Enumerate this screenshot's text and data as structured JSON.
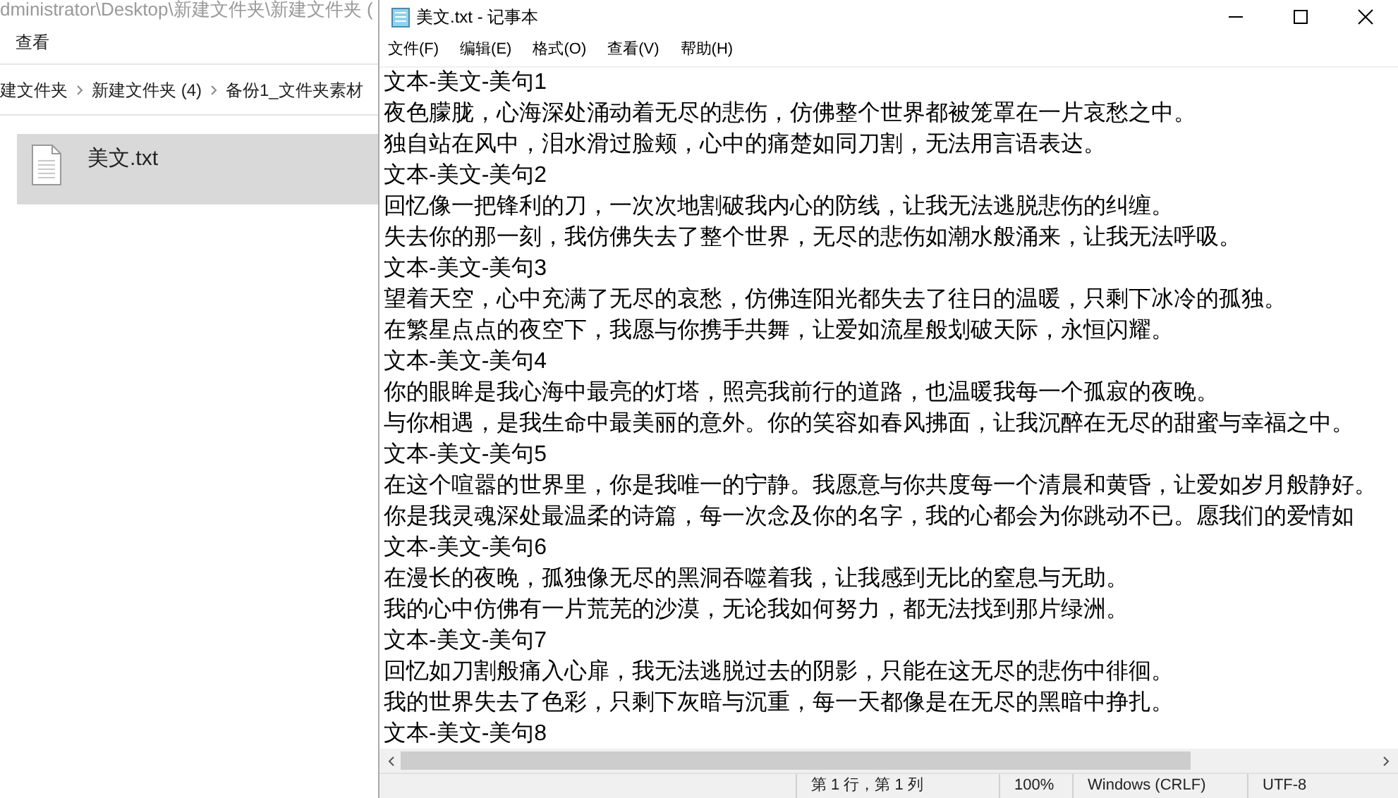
{
  "explorer": {
    "address": "dministrator\\Desktop\\新建文件夹\\新建文件夹 (",
    "ribbon_tab": "查看",
    "breadcrumb": [
      "建文件夹",
      "新建文件夹 (4)",
      "备份1_文件夹素材"
    ],
    "files": [
      {
        "name": "美文.txt",
        "selected": true
      }
    ]
  },
  "notepad": {
    "title": "美文.txt - 记事本",
    "menu": [
      "文件(F)",
      "编辑(E)",
      "格式(O)",
      "查看(V)",
      "帮助(H)"
    ],
    "lines": [
      "文本-美文-美句1",
      "夜色朦胧，心海深处涌动着无尽的悲伤，仿佛整个世界都被笼罩在一片哀愁之中。",
      "独自站在风中，泪水滑过脸颊，心中的痛楚如同刀割，无法用言语表达。",
      "文本-美文-美句2",
      "回忆像一把锋利的刀，一次次地割破我内心的防线，让我无法逃脱悲伤的纠缠。",
      "失去你的那一刻，我仿佛失去了整个世界，无尽的悲伤如潮水般涌来，让我无法呼吸。",
      "文本-美文-美句3",
      "望着天空，心中充满了无尽的哀愁，仿佛连阳光都失去了往日的温暖，只剩下冰冷的孤独。",
      "在繁星点点的夜空下，我愿与你携手共舞，让爱如流星般划破天际，永恒闪耀。",
      "文本-美文-美句4",
      "你的眼眸是我心海中最亮的灯塔，照亮我前行的道路，也温暖我每一个孤寂的夜晚。",
      "与你相遇，是我生命中最美丽的意外。你的笑容如春风拂面，让我沉醉在无尽的甜蜜与幸福之中。",
      "文本-美文-美句5",
      "在这个喧嚣的世界里，你是我唯一的宁静。我愿意与你共度每一个清晨和黄昏，让爱如岁月般静好。",
      "你是我灵魂深处最温柔的诗篇，每一次念及你的名字，我的心都会为你跳动不已。愿我们的爱情如",
      "文本-美文-美句6",
      "在漫长的夜晚，孤独像无尽的黑洞吞噬着我，让我感到无比的窒息与无助。",
      "我的心中仿佛有一片荒芜的沙漠，无论我如何努力，都无法找到那片绿洲。",
      "文本-美文-美句7",
      "回忆如刀割般痛入心扉，我无法逃脱过去的阴影，只能在这无尽的悲伤中徘徊。",
      "我的世界失去了色彩，只剩下灰暗与沉重，每一天都像是在无尽的黑暗中挣扎。",
      "文本-美文-美句8"
    ],
    "status": [
      "第 1 行，第 1 列",
      "100%",
      "Windows (CRLF)",
      "UTF-8"
    ]
  }
}
